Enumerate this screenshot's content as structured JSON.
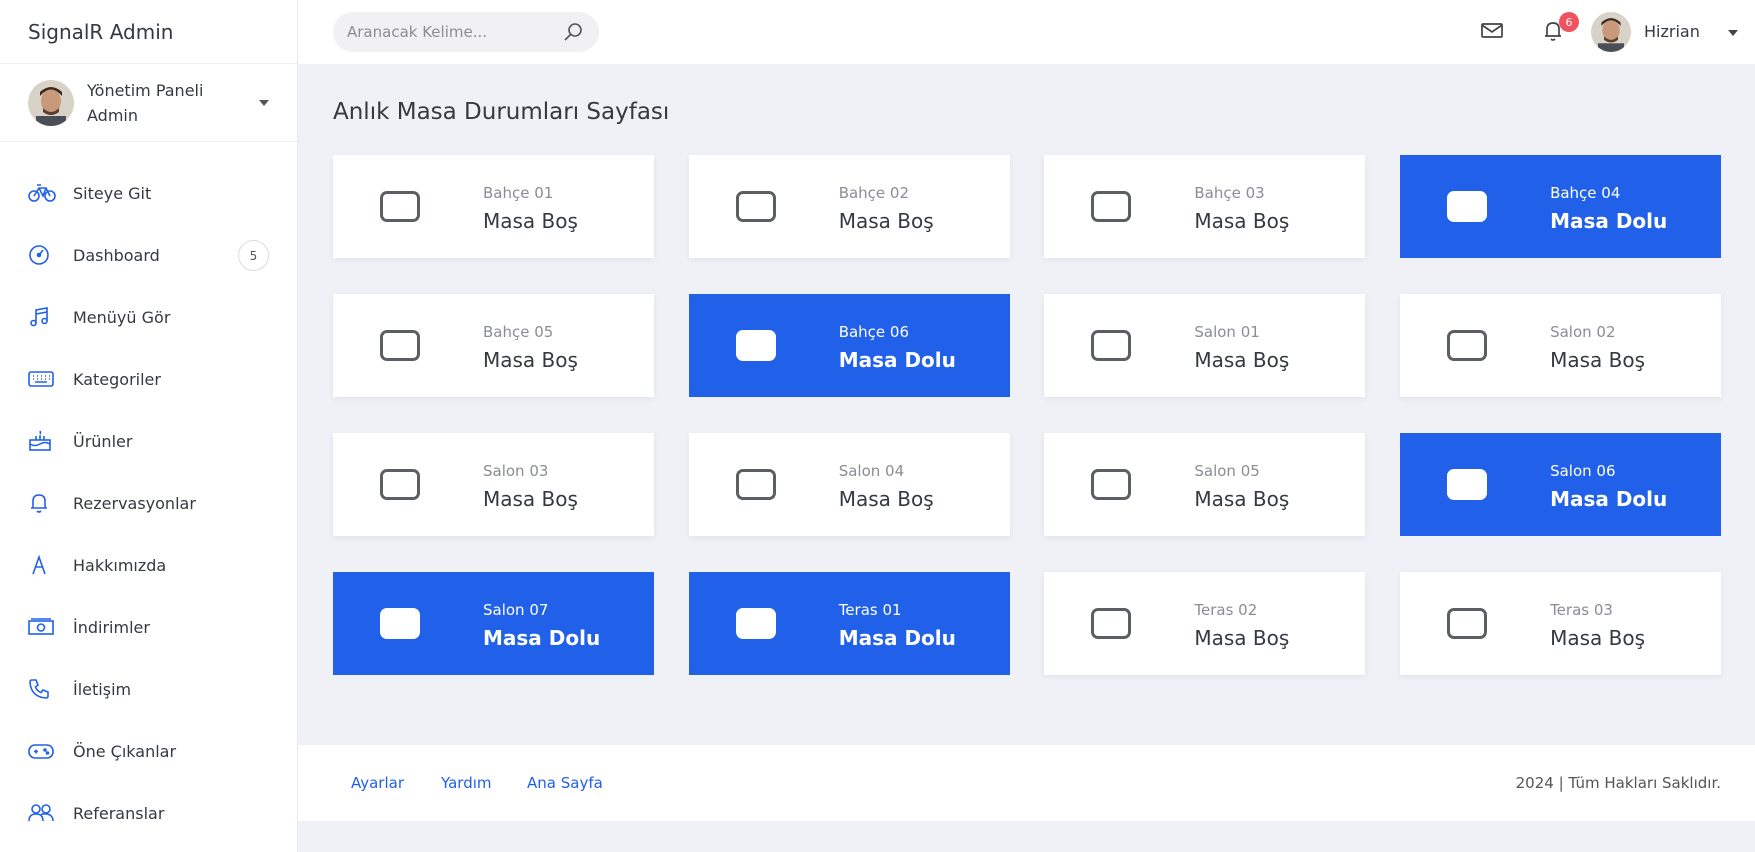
{
  "app": {
    "brand": "SignalR Admin"
  },
  "profile": {
    "line1": "Yönetim Paneli",
    "line2": "Admin"
  },
  "sidebar": {
    "items": [
      {
        "label": "Siteye Git",
        "icon": "bicycle-icon"
      },
      {
        "label": "Dashboard",
        "icon": "gauge-icon",
        "badge": "5"
      },
      {
        "label": "Menüyü Gör",
        "icon": "music-note-icon"
      },
      {
        "label": "Kategoriler",
        "icon": "keyboard-icon"
      },
      {
        "label": "Ürünler",
        "icon": "cake-icon"
      },
      {
        "label": "Rezervasyonlar",
        "icon": "bell-icon"
      },
      {
        "label": "Hakkımızda",
        "icon": "letter-a-icon"
      },
      {
        "label": "İndirimler",
        "icon": "money-icon"
      },
      {
        "label": "İletişim",
        "icon": "phone-icon"
      },
      {
        "label": "Öne Çıkanlar",
        "icon": "gamepad-icon"
      },
      {
        "label": "Referanslar",
        "icon": "users-icon"
      }
    ]
  },
  "search": {
    "placeholder": "Aranacak Kelime..."
  },
  "header": {
    "notification_count": "6",
    "user_name": "Hizrian"
  },
  "page": {
    "title": "Anlık Masa Durumları Sayfası"
  },
  "tables": [
    {
      "name": "Bahçe 01",
      "status": "Masa Boş",
      "occupied": false
    },
    {
      "name": "Bahçe 02",
      "status": "Masa Boş",
      "occupied": false
    },
    {
      "name": "Bahçe 03",
      "status": "Masa Boş",
      "occupied": false
    },
    {
      "name": "Bahçe 04",
      "status": "Masa Dolu",
      "occupied": true
    },
    {
      "name": "Bahçe 05",
      "status": "Masa Boş",
      "occupied": false
    },
    {
      "name": "Bahçe 06",
      "status": "Masa Dolu",
      "occupied": true
    },
    {
      "name": "Salon 01",
      "status": "Masa Boş",
      "occupied": false
    },
    {
      "name": "Salon 02",
      "status": "Masa Boş",
      "occupied": false
    },
    {
      "name": "Salon 03",
      "status": "Masa Boş",
      "occupied": false
    },
    {
      "name": "Salon 04",
      "status": "Masa Boş",
      "occupied": false
    },
    {
      "name": "Salon 05",
      "status": "Masa Boş",
      "occupied": false
    },
    {
      "name": "Salon 06",
      "status": "Masa Dolu",
      "occupied": true
    },
    {
      "name": "Salon 07",
      "status": "Masa Dolu",
      "occupied": true
    },
    {
      "name": "Teras 01",
      "status": "Masa Dolu",
      "occupied": true
    },
    {
      "name": "Teras 02",
      "status": "Masa Boş",
      "occupied": false
    },
    {
      "name": "Teras 03",
      "status": "Masa Boş",
      "occupied": false
    }
  ],
  "footer": {
    "links": [
      "Ayarlar",
      "Yardım",
      "Ana Sayfa"
    ],
    "copyright": "2024 | Tüm Hakları Saklıdır."
  },
  "colors": {
    "accent": "#2160e8",
    "badge": "#f0535e",
    "background": "#f0f1f7"
  }
}
